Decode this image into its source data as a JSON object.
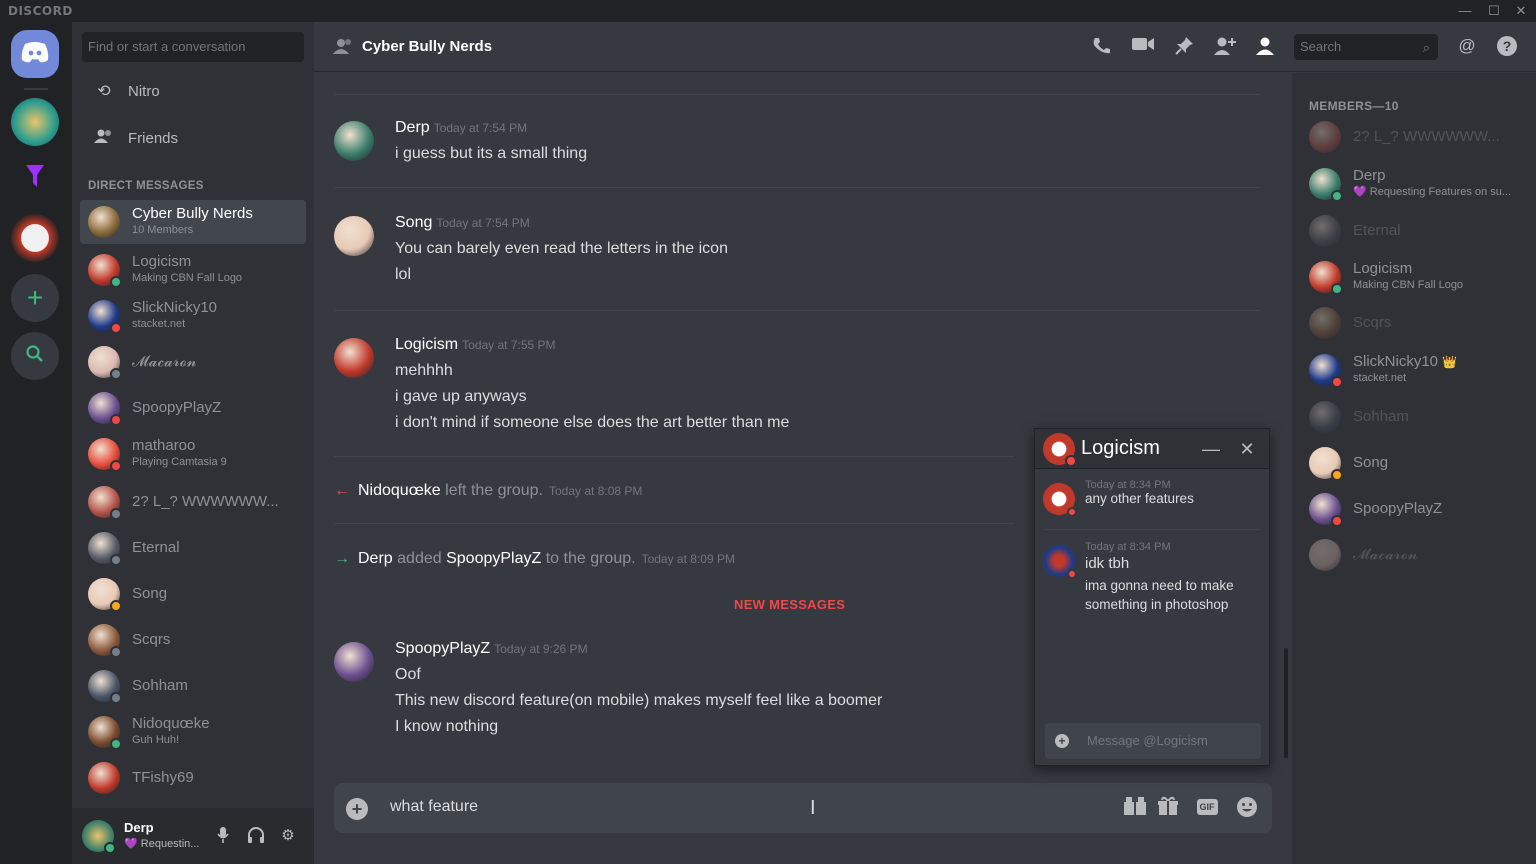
{
  "app": {
    "brand": "DISCORD"
  },
  "window_controls": {
    "minimize": "—",
    "maximize": "☐",
    "close": "✕"
  },
  "colors": {
    "background": "#36393f",
    "sidebar": "#2f3136",
    "guild_bar": "#202225",
    "blurple": "#7289da",
    "online": "#43b581",
    "dnd": "#f04747",
    "idle": "#faa61a",
    "offline": "#747f8d",
    "new_messages": "#f04747"
  },
  "dm_sidebar": {
    "search_placeholder": "Find or start a conversation",
    "nav": [
      {
        "label": "Nitro",
        "icon": "nitro-icon"
      },
      {
        "label": "Friends",
        "icon": "friends-icon"
      }
    ],
    "section_header": "DIRECT MESSAGES",
    "dms": [
      {
        "name": "Cyber Bully Nerds",
        "sub": "10 Members",
        "status": "none",
        "color": "#8a6a3a",
        "active": true
      },
      {
        "name": "Logicism",
        "sub": "Making CBN Fall Logo",
        "status": "on",
        "color": "#c0392b"
      },
      {
        "name": "SlickNicky10",
        "sub": "stacket.net",
        "status": "dnd",
        "color": "#1e3a8a"
      },
      {
        "name": "𝓜𝓪𝓬𝓪𝓻𝓸𝓷",
        "sub": "",
        "status": "off",
        "color": "#d9b8b0"
      },
      {
        "name": "SpoopyPlayZ",
        "sub": "",
        "status": "dnd",
        "color": "#6b4f8f"
      },
      {
        "name": "matharoo",
        "sub": "Playing Camtasia 9",
        "status": "dnd",
        "color": "#e74c3c"
      },
      {
        "name": "2? L_? WWWWWW...",
        "sub": "",
        "status": "off",
        "color": "#b5534a"
      },
      {
        "name": "Eternal",
        "sub": "",
        "status": "off",
        "color": "#555b66"
      },
      {
        "name": "Song",
        "sub": "",
        "status": "idle",
        "color": "#e8c9b6"
      },
      {
        "name": "Scqrs",
        "sub": "",
        "status": "off",
        "color": "#8b5a3c"
      },
      {
        "name": "Sohham",
        "sub": "",
        "status": "off",
        "color": "#4a5568"
      },
      {
        "name": "Nidoquœke",
        "sub": "Guh Huh!",
        "status": "on",
        "color": "#7a4a2e"
      },
      {
        "name": "TFishy69",
        "sub": "",
        "status": "none",
        "color": "#c0392b"
      }
    ]
  },
  "user_panel": {
    "name": "Derp",
    "status_text": "Requestin...",
    "status": "on",
    "icons": [
      "microphone-icon",
      "headphones-icon",
      "settings-icon"
    ]
  },
  "header": {
    "title": "Cyber Bully Nerds",
    "search_placeholder": "Search",
    "icons": [
      "call-icon",
      "video-icon",
      "pin-icon",
      "add-member-icon",
      "members-icon",
      "mention-icon",
      "help-icon"
    ]
  },
  "messages": [
    {
      "author": "Derp",
      "time": "Today at 7:54 PM",
      "lines": [
        "i guess but its a small thing"
      ],
      "color": "#3a7d6a"
    },
    {
      "author": "Song",
      "time": "Today at 7:54 PM",
      "lines": [
        "You can barely even read the letters in the icon",
        "lol"
      ],
      "color": "#e8c9b6"
    },
    {
      "author": "Logicism",
      "time": "Today at 7:55 PM",
      "lines": [
        "mehhhh",
        "i gave up anyways",
        "i don't mind if someone else does the art better than me"
      ],
      "color": "#c0392b"
    },
    {
      "author": "SpoopyPlayZ",
      "time": "Today at 9:26 PM",
      "lines": [
        "Oof",
        "This new discord feature(on mobile)  makes myself feel like a boomer",
        "I know nothing"
      ],
      "color": "#6b4f8f"
    }
  ],
  "system": [
    {
      "actor": "Nidoquœke",
      "text": "left the group.",
      "time": "Today at 8:08 PM"
    },
    {
      "actor": "Derp",
      "text": "added",
      "target": "SpoopyPlayZ",
      "text2": "to the group.",
      "time": "Today at 8:09 PM"
    }
  ],
  "new_messages_label": "NEW MESSAGES",
  "composer": {
    "text": "what feature",
    "icons": [
      "gift-card-icon",
      "gift-icon",
      "gif-icon",
      "emoji-icon"
    ],
    "gif_label": "GIF"
  },
  "members": {
    "header": "MEMBERS—10",
    "list": [
      {
        "name": "2? L_? WWWWWW...",
        "sub": "",
        "status": "off",
        "offline": true,
        "color": "#b5534a"
      },
      {
        "name": "Derp",
        "sub": "💜 Requesting Features on su...",
        "status": "on",
        "offline": false,
        "color": "#3a7d6a"
      },
      {
        "name": "Eternal",
        "sub": "",
        "status": "off",
        "offline": true,
        "color": "#555b66"
      },
      {
        "name": "Logicism",
        "sub": "Making CBN Fall Logo",
        "status": "on",
        "offline": false,
        "color": "#c0392b"
      },
      {
        "name": "Scqrs",
        "sub": "",
        "status": "off",
        "offline": true,
        "color": "#8b5a3c"
      },
      {
        "name": "SlickNicky10",
        "sub": "stacket.net",
        "status": "dnd",
        "offline": false,
        "color": "#1e3a8a",
        "crown": "👑"
      },
      {
        "name": "Sohham",
        "sub": "",
        "status": "off",
        "offline": true,
        "color": "#4a5568"
      },
      {
        "name": "Song",
        "sub": "",
        "status": "idle",
        "offline": false,
        "color": "#e8c9b6"
      },
      {
        "name": "SpoopyPlayZ",
        "sub": "",
        "status": "dnd",
        "offline": false,
        "color": "#6b4f8f"
      },
      {
        "name": "𝓜𝓪𝓬𝓪𝓻𝓸𝓷",
        "sub": "",
        "status": "off",
        "offline": true,
        "color": "#d9b8b0"
      }
    ]
  },
  "popup": {
    "title": "Logicism",
    "messages": [
      {
        "time": "Today at 8:34 PM",
        "lines": [
          "any other features"
        ],
        "color": "#c0392b"
      },
      {
        "time": "Today at 8:34 PM",
        "lines": [
          "idk tbh",
          "ima gonna need to make",
          "something in photoshop"
        ],
        "color": "#1e3a8a"
      }
    ],
    "input_placeholder": "Message @Logicism"
  }
}
